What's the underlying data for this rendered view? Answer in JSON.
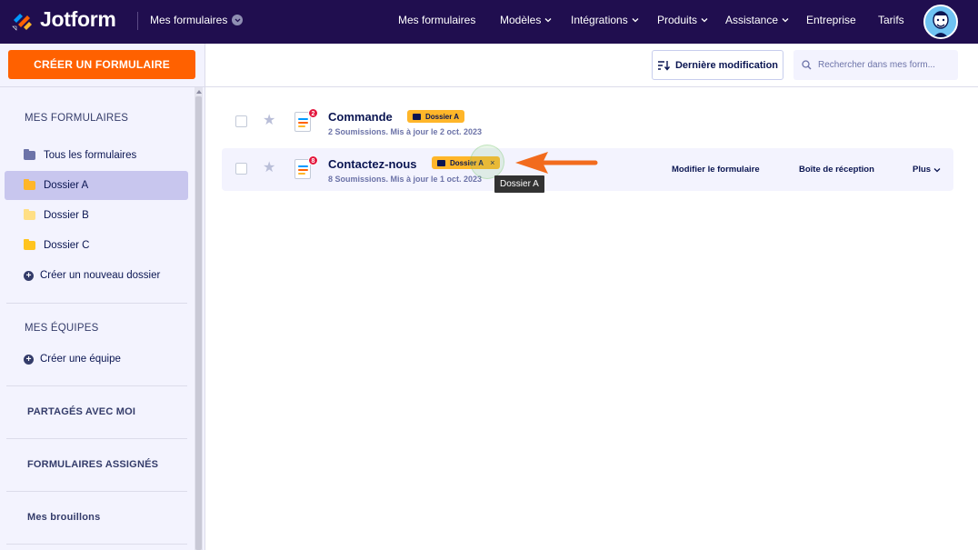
{
  "header": {
    "brand": "Jotform",
    "my_forms_menu": "Mes formulaires",
    "nav": [
      "Mes formulaires",
      "Modèles",
      "Intégrations",
      "Produits",
      "Assistance",
      "Entreprise",
      "Tarifs"
    ]
  },
  "toolbar": {
    "create_label": "CRÉER UN FORMULAIRE",
    "sort_label": "Dernière modification",
    "search_placeholder": "Rechercher dans mes form..."
  },
  "sidebar": {
    "my_forms_heading": "MES FORMULAIRES",
    "items": [
      {
        "label": "Tous les formulaires"
      },
      {
        "label": "Dossier A"
      },
      {
        "label": "Dossier B"
      },
      {
        "label": "Dossier C"
      },
      {
        "label": "Créer un nouveau dossier"
      }
    ],
    "teams_heading": "MES ÉQUIPES",
    "create_team": "Créer une équipe",
    "shared_heading": "PARTAGÉS AVEC MOI",
    "assigned_heading": "FORMULAIRES ASSIGNÉS",
    "drafts": "Mes brouillons"
  },
  "forms": [
    {
      "title": "Commande",
      "count": "2",
      "subtitle": "2 Soumissions. Mis à jour le 2 oct. 2023",
      "tag": "Dossier A"
    },
    {
      "title": "Contactez-nous",
      "count": "8",
      "subtitle": "8 Soumissions. Mis à jour le 1 oct. 2023",
      "tag": "Dossier A",
      "tag_remove": "×",
      "actions": {
        "edit": "Modifier le formulaire",
        "inbox": "Boîte de réception",
        "more": "Plus"
      }
    }
  ],
  "tooltip": "Dossier A",
  "colors": {
    "header_bg": "#200e4f",
    "accent_orange": "#ff6100",
    "tag_yellow": "#ffb629",
    "sidebar_active": "#c8c6ee"
  }
}
